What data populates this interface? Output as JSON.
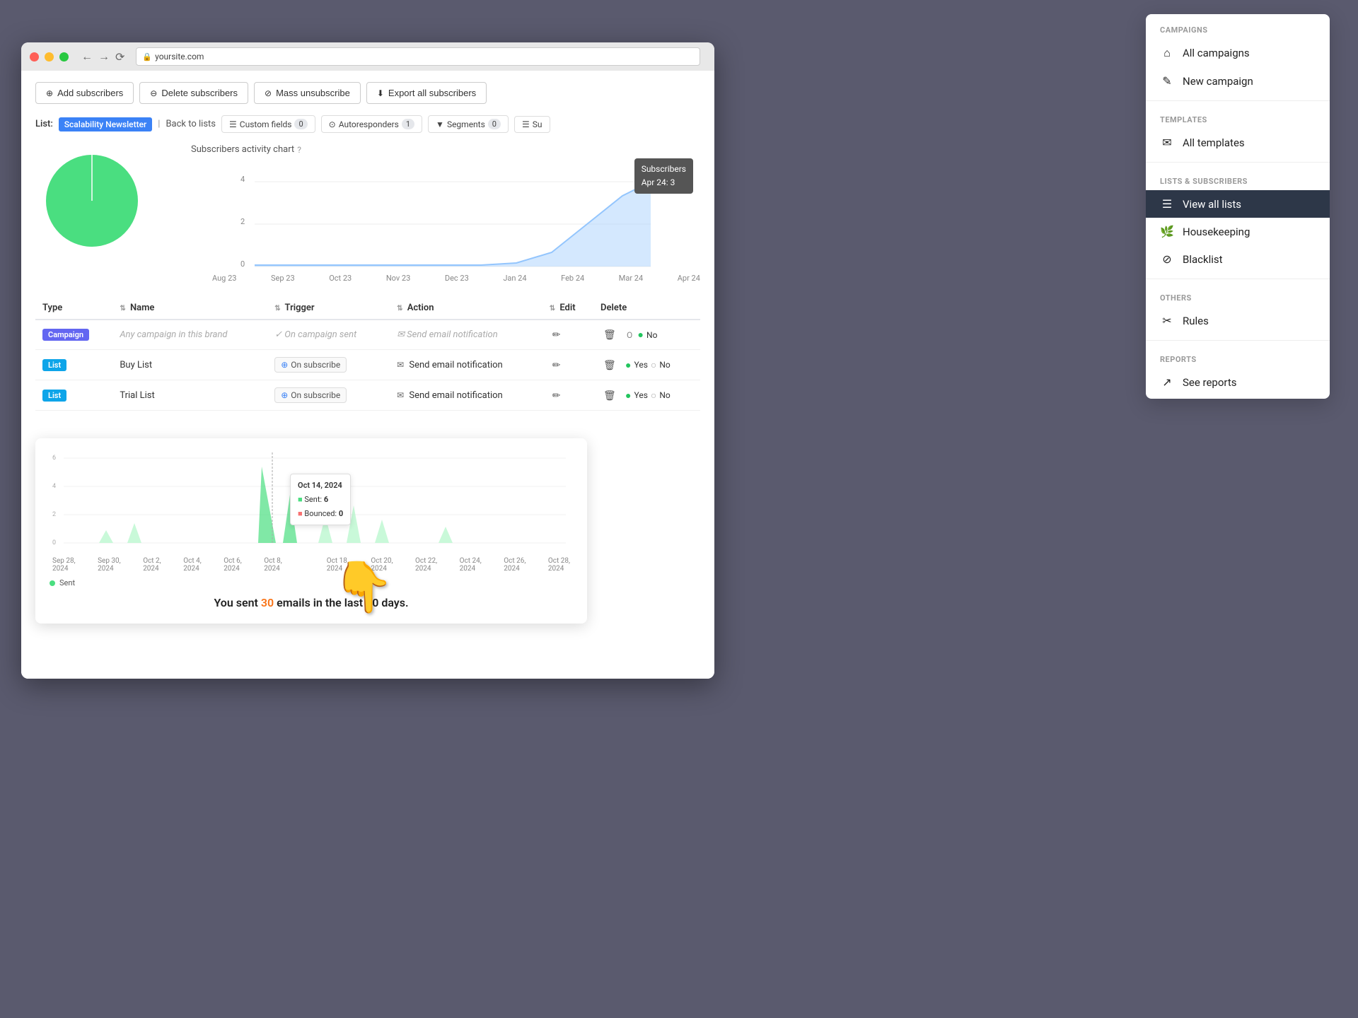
{
  "browser": {
    "url": "yoursite.com"
  },
  "toolbar": {
    "add_subscribers": "Add subscribers",
    "delete_subscribers": "Delete subscribers",
    "mass_unsubscribe": "Mass unsubscribe",
    "export_all": "Export all subscribers"
  },
  "list_nav": {
    "list_label": "List:",
    "list_name": "Scalability Newsletter",
    "back_link": "Back to lists",
    "custom_fields": "Custom fields",
    "custom_fields_count": "0",
    "autoresponders": "Autoresponders",
    "autoresponders_count": "1",
    "segments": "Segments",
    "segments_count": "0",
    "subscribers_tab": "Su"
  },
  "chart": {
    "title": "Subscribers activity chart",
    "tooltip": {
      "label": "Subscribers",
      "date": "Apr 24: 3"
    },
    "x_labels": [
      "Aug 23",
      "Sep 23",
      "Oct 23",
      "Nov 23",
      "Dec 23",
      "Jan 24",
      "Feb 24",
      "Mar 24",
      "Apr 24"
    ],
    "y_labels": [
      "0",
      "2",
      "4"
    ]
  },
  "table": {
    "headers": {
      "type": "Type",
      "name": "Name",
      "trigger": "Trigger",
      "action": "Action",
      "edit": "Edit",
      "delete": "Delete"
    },
    "rows": [
      {
        "type": "Campaign",
        "type_class": "campaign",
        "name": "Any campaign in this brand",
        "name_grayed": true,
        "trigger": "On campaign sent",
        "trigger_grayed": true,
        "action": "Send email notification",
        "action_grayed": true,
        "active_yes": false,
        "active_no": true,
        "show_radio": false
      },
      {
        "type": "List",
        "type_class": "list",
        "name": "Buy List",
        "name_grayed": false,
        "trigger": "On subscribe",
        "trigger_grayed": false,
        "action": "Send email notification",
        "action_grayed": false,
        "active_yes": true,
        "active_no": false,
        "show_radio": true
      },
      {
        "type": "List",
        "type_class": "list",
        "name": "Trial List",
        "name_grayed": false,
        "trigger": "On subscribe",
        "trigger_grayed": false,
        "action": "Send email notification",
        "action_grayed": false,
        "active_yes": true,
        "active_no": false,
        "show_radio": true
      }
    ]
  },
  "bottom_chart": {
    "tooltip": {
      "date": "Oct 14, 2024",
      "sent_label": "Sent:",
      "sent_value": "6",
      "bounced_label": "Bounced:",
      "bounced_value": "0"
    },
    "x_labels": [
      "Sep 28, 2024",
      "Sep 30, 2024",
      "Oct 2, 2024",
      "Oct 4, 2024",
      "Oct 6, 2024",
      "Oct 8, 2024",
      "",
      "Oct 18, 2024",
      "Oct 20, 2024",
      "Oct 22, 2024",
      "Oct 24, 2024",
      "Oct 26, 2024",
      "Oct 28, 2024"
    ],
    "legend_sent": "Sent",
    "summary": "You sent",
    "count": "30",
    "summary_end": "emails in the last 30 days."
  },
  "dropdown": {
    "campaigns_section": "CAMPAIGNS",
    "all_campaigns": "All campaigns",
    "new_campaign": "New campaign",
    "templates_section": "TEMPLATES",
    "all_templates": "All templates",
    "lists_section": "LISTS & SUBSCRIBERS",
    "view_all_lists": "View all lists",
    "housekeeping": "Housekeeping",
    "blacklist": "Blacklist",
    "others_section": "OTHERS",
    "rules": "Rules",
    "reports_section": "REPORTS",
    "see_reports": "See reports"
  }
}
